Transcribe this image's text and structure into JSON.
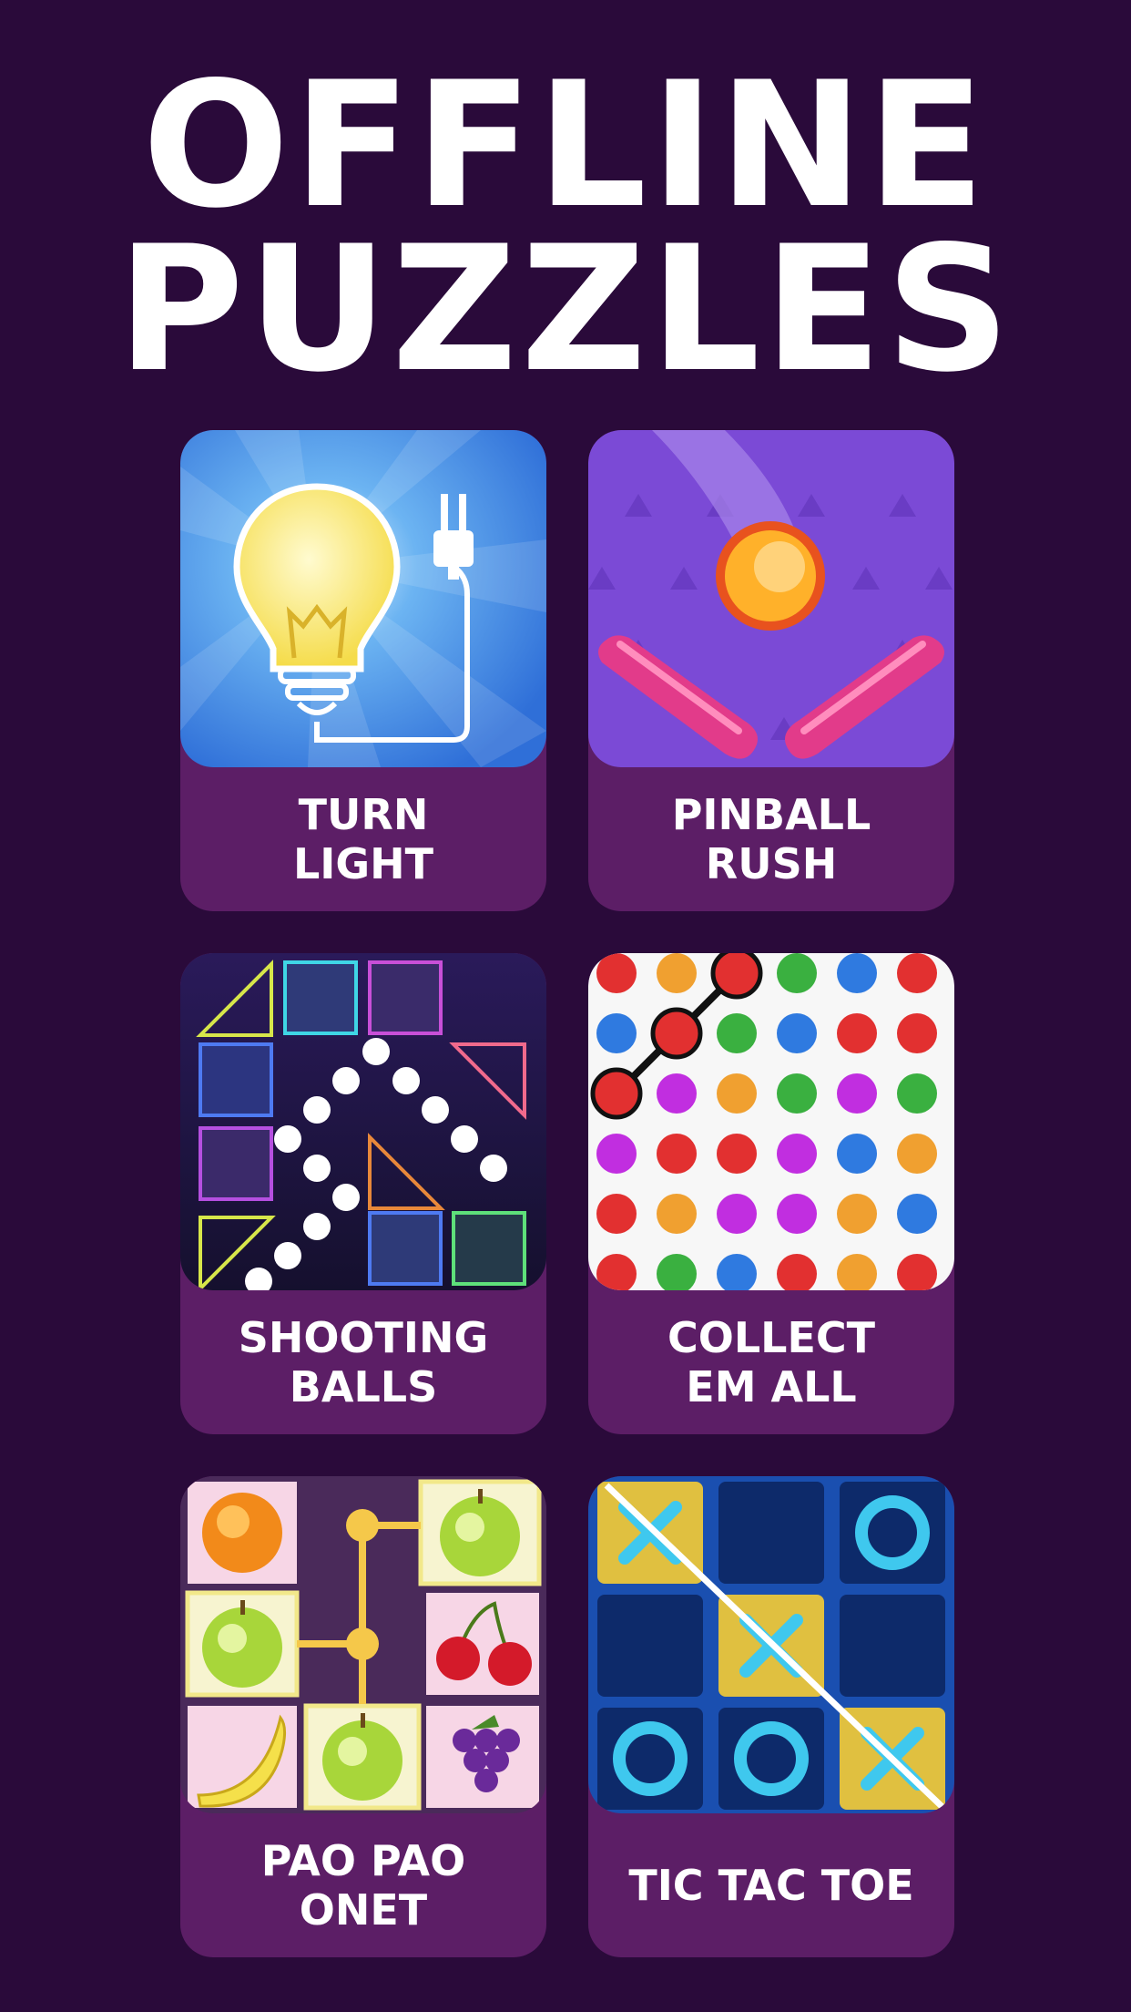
{
  "headline": {
    "line1": "OFFLINE",
    "line2": "PUZZLES"
  },
  "games": [
    {
      "label": "TURN\nLIGHT",
      "icon": "lightbulb-icon"
    },
    {
      "label": "PINBALL\nRUSH",
      "icon": "pinball-icon"
    },
    {
      "label": "SHOOTING\nBALLS",
      "icon": "shooting-balls-icon"
    },
    {
      "label": "COLLECT\nEM ALL",
      "icon": "dots-grid-icon"
    },
    {
      "label": "PAO PAO\nONET",
      "icon": "fruit-tiles-icon"
    },
    {
      "label": "TIC TAC TOE",
      "icon": "tic-tac-toe-icon"
    }
  ],
  "colors": {
    "background": "#2a0a3a",
    "card": "#5c1e66",
    "text": "#ffffff"
  }
}
